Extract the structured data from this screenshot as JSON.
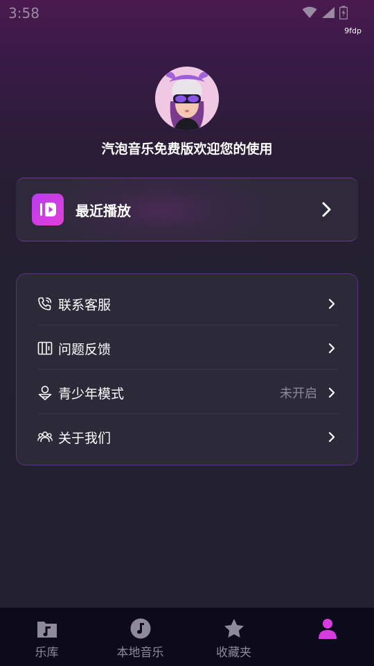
{
  "status_bar": {
    "time": "3:58",
    "debug_tag": "9fdp"
  },
  "profile": {
    "welcome_text": "汽泡音乐免费版欢迎您的使用"
  },
  "recent": {
    "label": "最近播放"
  },
  "menu": {
    "items": [
      {
        "label": "联系客服",
        "value": "",
        "icon": "phone-icon"
      },
      {
        "label": "问题反馈",
        "value": "",
        "icon": "feedback-icon"
      },
      {
        "label": "青少年模式",
        "value": "未开启",
        "icon": "youth-mode-icon"
      },
      {
        "label": "关于我们",
        "value": "",
        "icon": "group-icon"
      }
    ]
  },
  "tabbar": {
    "tabs": [
      {
        "label": "乐库",
        "icon": "music-folder-icon",
        "active": false
      },
      {
        "label": "本地音乐",
        "icon": "music-disc-icon",
        "active": false
      },
      {
        "label": "收藏夹",
        "icon": "star-icon",
        "active": false
      },
      {
        "label": "",
        "icon": "person-icon",
        "active": true
      }
    ]
  },
  "colors": {
    "accent": "#d63ce0",
    "card_border": "#5e2f84",
    "tabbar_bg": "#0d0a1c",
    "muted_text": "#8e8a99"
  }
}
